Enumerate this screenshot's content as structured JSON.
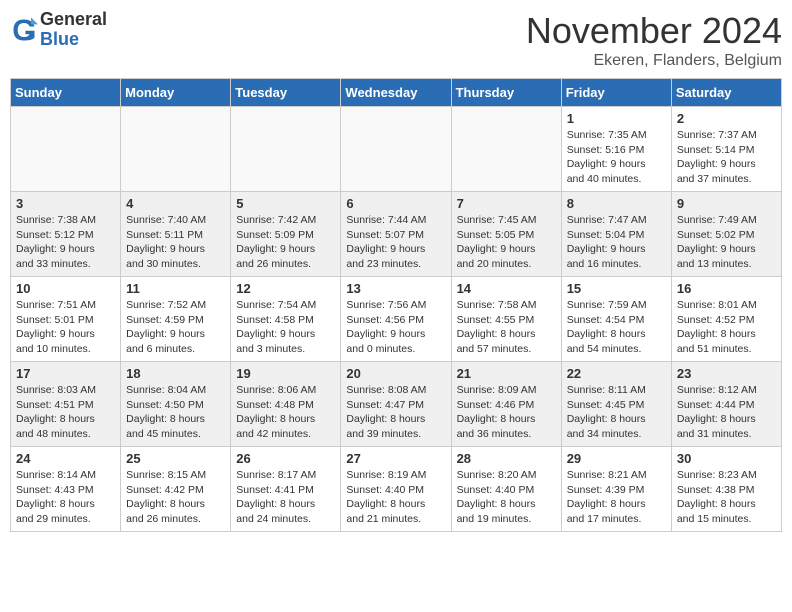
{
  "logo": {
    "general": "General",
    "blue": "Blue"
  },
  "title": "November 2024",
  "location": "Ekeren, Flanders, Belgium",
  "days_of_week": [
    "Sunday",
    "Monday",
    "Tuesday",
    "Wednesday",
    "Thursday",
    "Friday",
    "Saturday"
  ],
  "weeks": [
    [
      {
        "day": "",
        "info": ""
      },
      {
        "day": "",
        "info": ""
      },
      {
        "day": "",
        "info": ""
      },
      {
        "day": "",
        "info": ""
      },
      {
        "day": "",
        "info": ""
      },
      {
        "day": "1",
        "info": "Sunrise: 7:35 AM\nSunset: 5:16 PM\nDaylight: 9 hours\nand 40 minutes."
      },
      {
        "day": "2",
        "info": "Sunrise: 7:37 AM\nSunset: 5:14 PM\nDaylight: 9 hours\nand 37 minutes."
      }
    ],
    [
      {
        "day": "3",
        "info": "Sunrise: 7:38 AM\nSunset: 5:12 PM\nDaylight: 9 hours\nand 33 minutes."
      },
      {
        "day": "4",
        "info": "Sunrise: 7:40 AM\nSunset: 5:11 PM\nDaylight: 9 hours\nand 30 minutes."
      },
      {
        "day": "5",
        "info": "Sunrise: 7:42 AM\nSunset: 5:09 PM\nDaylight: 9 hours\nand 26 minutes."
      },
      {
        "day": "6",
        "info": "Sunrise: 7:44 AM\nSunset: 5:07 PM\nDaylight: 9 hours\nand 23 minutes."
      },
      {
        "day": "7",
        "info": "Sunrise: 7:45 AM\nSunset: 5:05 PM\nDaylight: 9 hours\nand 20 minutes."
      },
      {
        "day": "8",
        "info": "Sunrise: 7:47 AM\nSunset: 5:04 PM\nDaylight: 9 hours\nand 16 minutes."
      },
      {
        "day": "9",
        "info": "Sunrise: 7:49 AM\nSunset: 5:02 PM\nDaylight: 9 hours\nand 13 minutes."
      }
    ],
    [
      {
        "day": "10",
        "info": "Sunrise: 7:51 AM\nSunset: 5:01 PM\nDaylight: 9 hours\nand 10 minutes."
      },
      {
        "day": "11",
        "info": "Sunrise: 7:52 AM\nSunset: 4:59 PM\nDaylight: 9 hours\nand 6 minutes."
      },
      {
        "day": "12",
        "info": "Sunrise: 7:54 AM\nSunset: 4:58 PM\nDaylight: 9 hours\nand 3 minutes."
      },
      {
        "day": "13",
        "info": "Sunrise: 7:56 AM\nSunset: 4:56 PM\nDaylight: 9 hours\nand 0 minutes."
      },
      {
        "day": "14",
        "info": "Sunrise: 7:58 AM\nSunset: 4:55 PM\nDaylight: 8 hours\nand 57 minutes."
      },
      {
        "day": "15",
        "info": "Sunrise: 7:59 AM\nSunset: 4:54 PM\nDaylight: 8 hours\nand 54 minutes."
      },
      {
        "day": "16",
        "info": "Sunrise: 8:01 AM\nSunset: 4:52 PM\nDaylight: 8 hours\nand 51 minutes."
      }
    ],
    [
      {
        "day": "17",
        "info": "Sunrise: 8:03 AM\nSunset: 4:51 PM\nDaylight: 8 hours\nand 48 minutes."
      },
      {
        "day": "18",
        "info": "Sunrise: 8:04 AM\nSunset: 4:50 PM\nDaylight: 8 hours\nand 45 minutes."
      },
      {
        "day": "19",
        "info": "Sunrise: 8:06 AM\nSunset: 4:48 PM\nDaylight: 8 hours\nand 42 minutes."
      },
      {
        "day": "20",
        "info": "Sunrise: 8:08 AM\nSunset: 4:47 PM\nDaylight: 8 hours\nand 39 minutes."
      },
      {
        "day": "21",
        "info": "Sunrise: 8:09 AM\nSunset: 4:46 PM\nDaylight: 8 hours\nand 36 minutes."
      },
      {
        "day": "22",
        "info": "Sunrise: 8:11 AM\nSunset: 4:45 PM\nDaylight: 8 hours\nand 34 minutes."
      },
      {
        "day": "23",
        "info": "Sunrise: 8:12 AM\nSunset: 4:44 PM\nDaylight: 8 hours\nand 31 minutes."
      }
    ],
    [
      {
        "day": "24",
        "info": "Sunrise: 8:14 AM\nSunset: 4:43 PM\nDaylight: 8 hours\nand 29 minutes."
      },
      {
        "day": "25",
        "info": "Sunrise: 8:15 AM\nSunset: 4:42 PM\nDaylight: 8 hours\nand 26 minutes."
      },
      {
        "day": "26",
        "info": "Sunrise: 8:17 AM\nSunset: 4:41 PM\nDaylight: 8 hours\nand 24 minutes."
      },
      {
        "day": "27",
        "info": "Sunrise: 8:19 AM\nSunset: 4:40 PM\nDaylight: 8 hours\nand 21 minutes."
      },
      {
        "day": "28",
        "info": "Sunrise: 8:20 AM\nSunset: 4:40 PM\nDaylight: 8 hours\nand 19 minutes."
      },
      {
        "day": "29",
        "info": "Sunrise: 8:21 AM\nSunset: 4:39 PM\nDaylight: 8 hours\nand 17 minutes."
      },
      {
        "day": "30",
        "info": "Sunrise: 8:23 AM\nSunset: 4:38 PM\nDaylight: 8 hours\nand 15 minutes."
      }
    ]
  ]
}
